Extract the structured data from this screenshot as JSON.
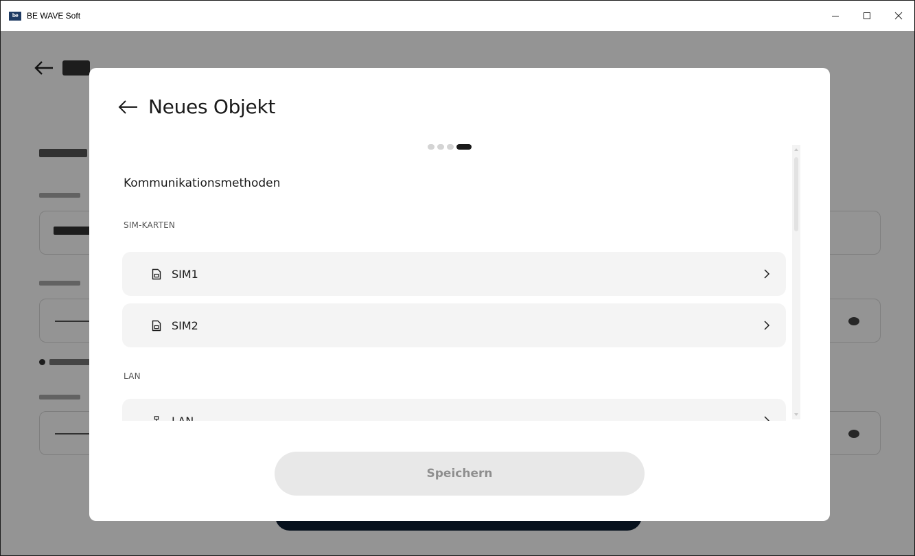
{
  "window": {
    "logo_text": "be",
    "title": "BE WAVE Soft"
  },
  "modal": {
    "title": "Neues Objekt",
    "stepper": {
      "total": 4,
      "current": 4
    },
    "section_title": "Kommunikationsmethoden",
    "groups": {
      "sim_label": "SIM-KARTEN",
      "sim1_label": "SIM1",
      "sim2_label": "SIM2",
      "lan_label": "LAN",
      "lan_item_label": "LAN"
    },
    "save_label": "Speichern"
  },
  "icons": {
    "back": "arrow-left-icon",
    "sim": "sim-card-icon",
    "lan": "network-icon",
    "chevron": "chevron-right-icon"
  },
  "colors": {
    "modal_bg": "#ffffff",
    "item_bg": "#f4f4f4",
    "save_bg": "#e8e8e8",
    "save_text": "#8e8e8e",
    "overlay": "#000000",
    "bg_button": "#0d1e33"
  }
}
